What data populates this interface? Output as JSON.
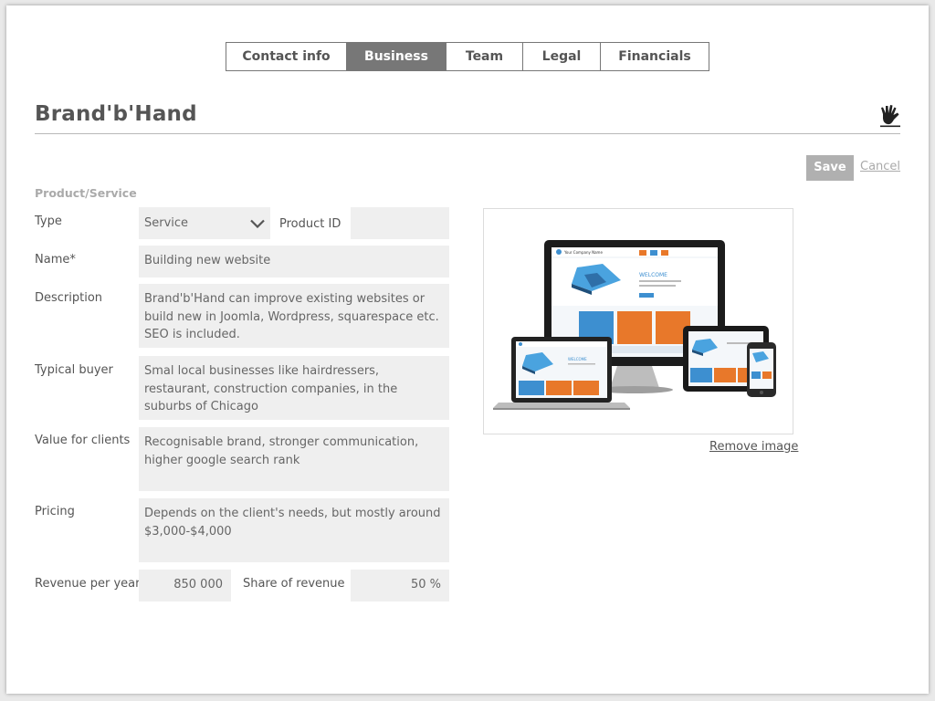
{
  "tabs": [
    {
      "label": "Contact info",
      "active": false
    },
    {
      "label": "Business",
      "active": true
    },
    {
      "label": "Team",
      "active": false
    },
    {
      "label": "Legal",
      "active": false
    },
    {
      "label": "Financials",
      "active": false
    }
  ],
  "header": {
    "title": "Brand'b'Hand",
    "logo_icon": "hand-icon"
  },
  "actions": {
    "save_label": "Save",
    "cancel_label": "Cancel"
  },
  "section": {
    "title": "Product/Service"
  },
  "form": {
    "type": {
      "label": "Type",
      "value": "Service"
    },
    "product_id": {
      "label": "Product ID",
      "value": ""
    },
    "name": {
      "label": "Name*",
      "value": "Building new website"
    },
    "description": {
      "label": "Description",
      "value": "Brand'b'Hand can improve existing websites or build new in Joomla, Wordpress, squarespace etc. SEO is included."
    },
    "typical_buyer": {
      "label": "Typical buyer",
      "value": "Smal local businesses like hairdressers, restaurant, construction companies, in the suburbs of Chicago"
    },
    "value_for_clients": {
      "label": "Value for clients",
      "value": "Recognisable brand, stronger communication, higher google search rank"
    },
    "pricing": {
      "label": "Pricing",
      "value": "Depends on the client's needs, but mostly around $3,000-$4,000"
    },
    "revenue": {
      "label": "Revenue per year",
      "value": "850 000"
    },
    "share": {
      "label": "Share of revenue",
      "value": "50 %"
    }
  },
  "image": {
    "remove_label": "Remove image",
    "mock_header": "Your Company Name",
    "mock_welcome": "WELCOME"
  },
  "colors": {
    "accent_blue": "#3d8fd0",
    "accent_orange": "#e8782a",
    "active_tab": "#777777",
    "save_button": "#b0b0b0"
  }
}
